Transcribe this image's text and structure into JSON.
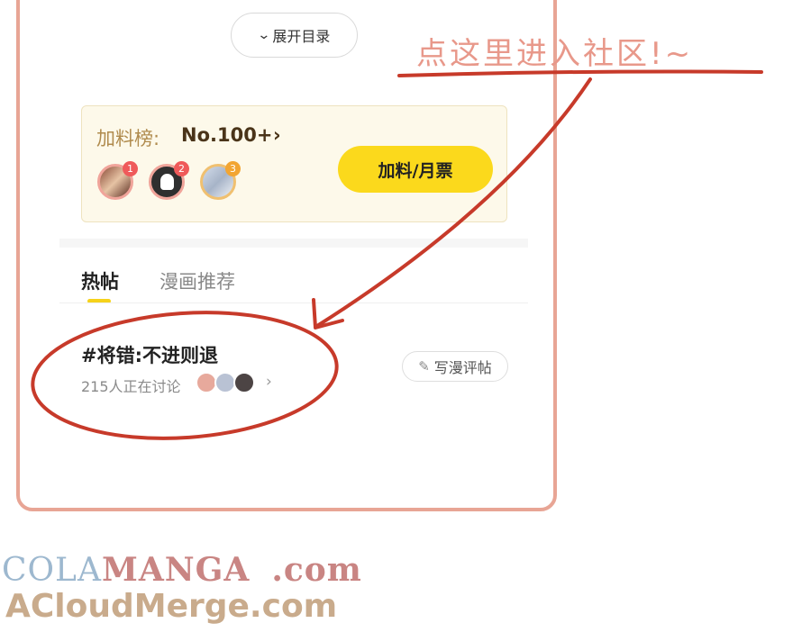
{
  "expand_button": {
    "label": "展开目录"
  },
  "ranking": {
    "label": "加料榜:",
    "value": "No.100+",
    "arrow": "›",
    "avatars": [
      {
        "rank": "1",
        "color": "#ef5a5a"
      },
      {
        "rank": "2",
        "color": "#ef5a5a"
      },
      {
        "rank": "3",
        "color": "#f2a532"
      }
    ],
    "ticket_button": "加料/月票"
  },
  "tabs": [
    {
      "label": "热帖",
      "active": true
    },
    {
      "label": "漫画推荐",
      "active": false
    }
  ],
  "post": {
    "title": "#将错:不进则退",
    "discussion": "215人正在讨论",
    "arrow": "›",
    "write_button": "写漫评帖"
  },
  "annotation": {
    "text": "点这里进入社区!~",
    "color": "#c73a2a"
  },
  "watermark": {
    "line1_part1": "COLA",
    "line1_part2": "MANGA",
    "line1_part3": ".com",
    "line2": "ACloudMerge.com"
  },
  "colors": {
    "accent_yellow": "#fbd91c",
    "frame_border": "#e8a595",
    "card_bg": "#fdf9ea"
  }
}
